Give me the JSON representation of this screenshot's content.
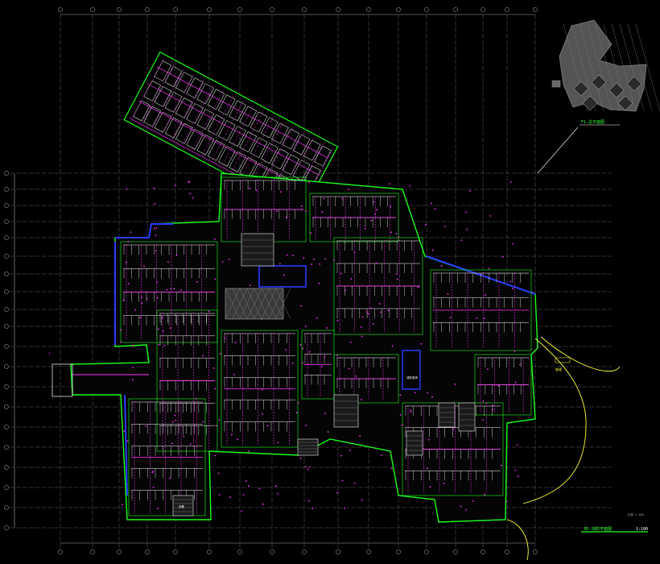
{
  "drawing": {
    "background": "#000000",
    "colors": {
      "grid": "#8a8a8a",
      "wall": "#ffffff",
      "boundary": "#1aff1a",
      "pipe": "#ff33ff",
      "blue": "#2a3cff",
      "yellow": "#ffff33",
      "green_label": "#33ff33"
    },
    "labels": {
      "inset_title": "F1-总平面图",
      "drawing_title": "B1-消防平面图",
      "scale": "1:100",
      "scale_note": "比例 1:100",
      "room_a": "消防泵房",
      "room_b": "设备",
      "ramp": "坡道"
    },
    "icons": {
      "north": "north-arrow-icon",
      "axis": "axis-bubble-icon"
    }
  }
}
